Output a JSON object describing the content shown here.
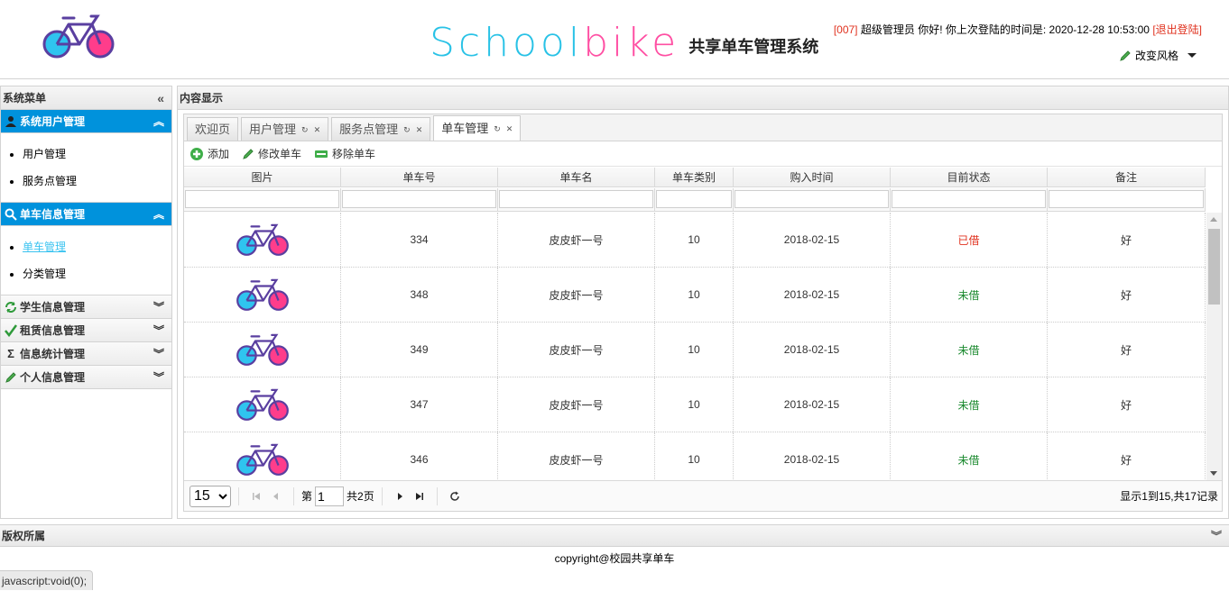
{
  "header": {
    "brand_school": "School",
    "brand_bike": "bike",
    "brand_sub": "共享单车管理系统",
    "user_id": "[007]",
    "user_greeting": "超级管理员 你好! 你上次登陆的时间是: 2020-12-28 10:53:00",
    "logout": "[退出登陆]",
    "style_switch": "改变风格"
  },
  "sidebar": {
    "title": "系统菜单",
    "groups": [
      {
        "label": "系统用户管理",
        "icon": "user-icon",
        "state": "open",
        "items": [
          "用户管理",
          "服务点管理"
        ]
      },
      {
        "label": "单车信息管理",
        "icon": "search-icon",
        "state": "open",
        "items": [
          "单车管理",
          "分类管理"
        ]
      },
      {
        "label": "学生信息管理",
        "icon": "refresh-icon",
        "state": "closed"
      },
      {
        "label": "租赁信息管理",
        "icon": "check-icon",
        "state": "closed"
      },
      {
        "label": "信息统计管理",
        "icon": "sigma-icon",
        "state": "closed"
      },
      {
        "label": "个人信息管理",
        "icon": "pencil-icon",
        "state": "closed"
      }
    ]
  },
  "content": {
    "title": "内容显示",
    "tabs": [
      {
        "label": "欢迎页",
        "selected": false
      },
      {
        "label": "用户管理",
        "selected": false
      },
      {
        "label": "服务点管理",
        "selected": false
      },
      {
        "label": "单车管理",
        "selected": true
      }
    ],
    "toolbar": {
      "add": "添加",
      "edit": "修改单车",
      "remove": "移除单车"
    },
    "columns": [
      "图片",
      "单车号",
      "单车名",
      "单车类别",
      "购入时间",
      "目前状态",
      "备注"
    ],
    "rows": [
      {
        "no": "334",
        "name": "皮皮虾一号",
        "type": "10",
        "date": "2018-02-15",
        "status": "已借",
        "remark": "好"
      },
      {
        "no": "348",
        "name": "皮皮虾一号",
        "type": "10",
        "date": "2018-02-15",
        "status": "未借",
        "remark": "好"
      },
      {
        "no": "349",
        "name": "皮皮虾一号",
        "type": "10",
        "date": "2018-02-15",
        "status": "未借",
        "remark": "好"
      },
      {
        "no": "347",
        "name": "皮皮虾一号",
        "type": "10",
        "date": "2018-02-15",
        "status": "未借",
        "remark": "好"
      },
      {
        "no": "346",
        "name": "皮皮虾一号",
        "type": "10",
        "date": "2018-02-15",
        "status": "未借",
        "remark": "好"
      }
    ],
    "pager": {
      "page_size": "15",
      "page_prefix": "第",
      "page_value": "1",
      "page_total": "共2页",
      "info": "显示1到15,共17记录"
    }
  },
  "footer": {
    "title": "版权所属",
    "copyright": "copyright@校园共享单车",
    "statusbar": "javascript:void(0);"
  },
  "colors": {
    "accent": "#0092dc",
    "status_out": "#e0321f",
    "status_in": "#1b8a2f",
    "brand_school": "#29c2e6",
    "brand_bike": "#ff4fa3"
  }
}
